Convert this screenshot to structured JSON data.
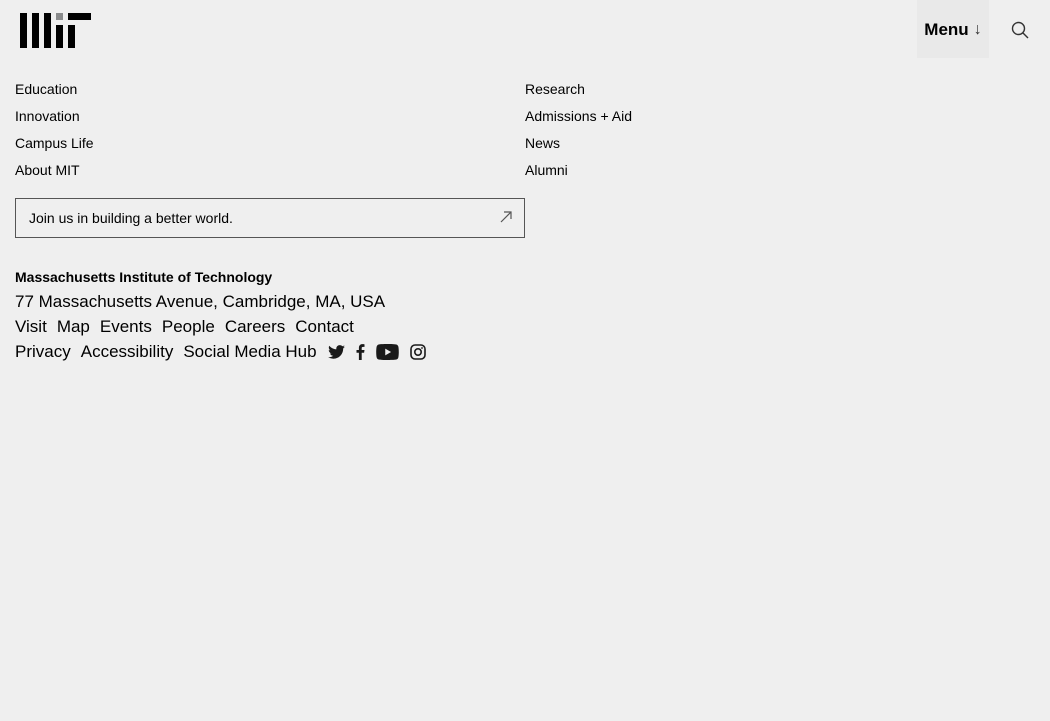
{
  "header": {
    "logo_text": "MIT",
    "menu_label": "Menu",
    "menu_arrow": "↓",
    "search_icon": "search-icon"
  },
  "nav": {
    "left": [
      {
        "label": "Education"
      },
      {
        "label": "Innovation"
      },
      {
        "label": "Campus Life"
      },
      {
        "label": "About MIT"
      }
    ],
    "right": [
      {
        "label": "Research"
      },
      {
        "label": "Admissions + Aid"
      },
      {
        "label": "News"
      },
      {
        "label": "Alumni"
      }
    ]
  },
  "cta": {
    "label": "Join us in building a better world.",
    "icon": "arrow-up-right-icon"
  },
  "footer": {
    "institute_name": "Massachusetts Institute of Technology",
    "address": "77 Massachusetts Avenue, Cambridge, MA, USA",
    "links_row1": [
      {
        "label": "Visit"
      },
      {
        "label": "Map"
      },
      {
        "label": "Events"
      },
      {
        "label": "People"
      },
      {
        "label": "Careers"
      },
      {
        "label": "Contact"
      }
    ],
    "links_row2": [
      {
        "label": "Privacy"
      },
      {
        "label": "Accessibility"
      },
      {
        "label": "Social Media Hub"
      }
    ],
    "social_icons": [
      "twitter-icon",
      "facebook-icon",
      "youtube-icon",
      "instagram-icon"
    ]
  },
  "colors": {
    "background": "#efefef",
    "text": "#000000",
    "logo_accent": "#8a8b8c"
  }
}
